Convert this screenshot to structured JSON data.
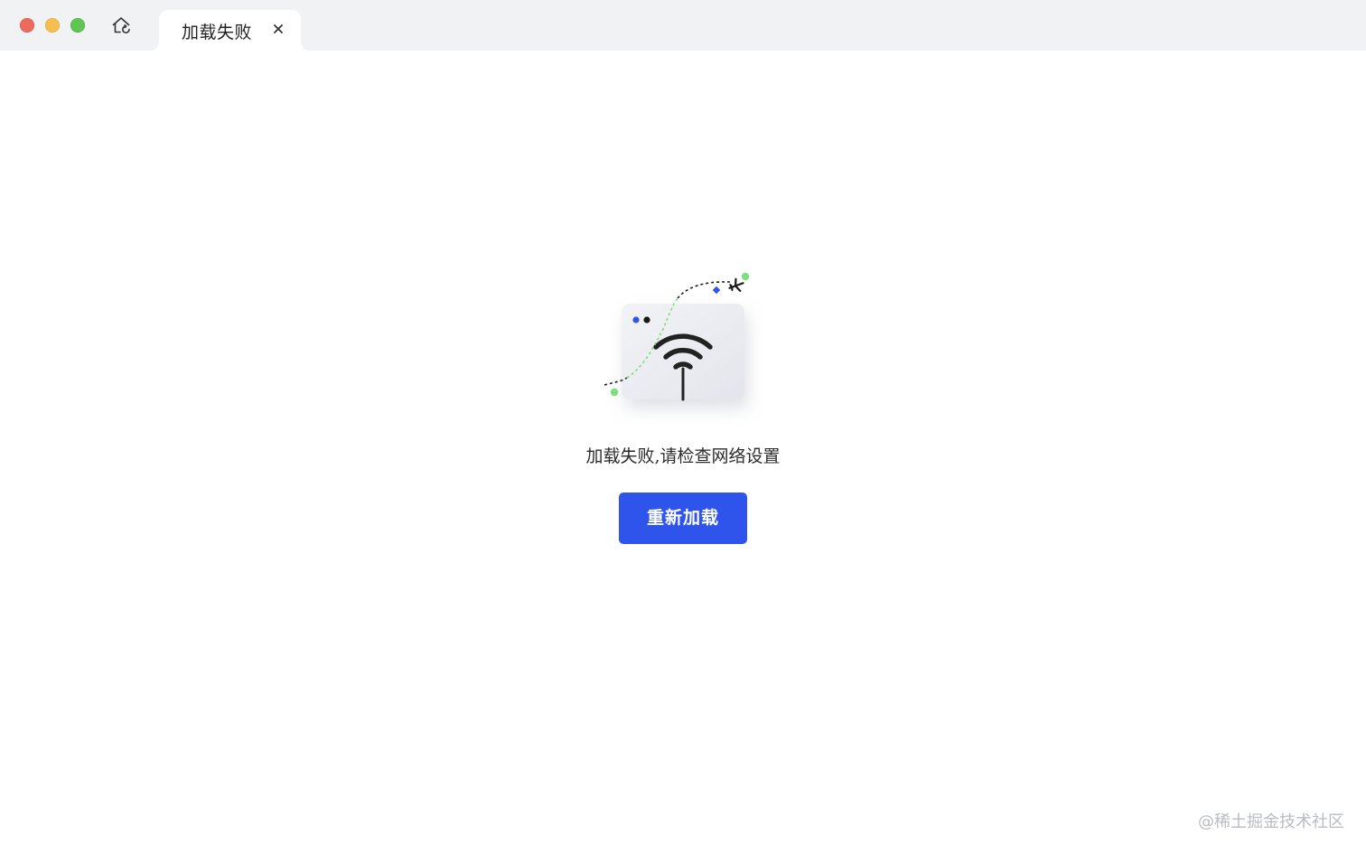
{
  "window": {
    "traffic_lights": [
      "close",
      "minimize",
      "maximize"
    ]
  },
  "toolbar": {
    "home_icon": "home-refresh-icon"
  },
  "tab": {
    "title": "加载失败",
    "close_icon": "close-icon"
  },
  "error": {
    "illustration_icon": "wifi-offline-illustration",
    "message": "加载失败,请检查网络设置",
    "reload_label": "重新加载"
  },
  "watermark": {
    "text": "@稀土掘金技术社区"
  },
  "colors": {
    "accent": "#2f54eb",
    "titlebar": "#f1f2f4",
    "close": "#ed6a5e",
    "minimize": "#f5bf4f",
    "maximize": "#61c554"
  }
}
